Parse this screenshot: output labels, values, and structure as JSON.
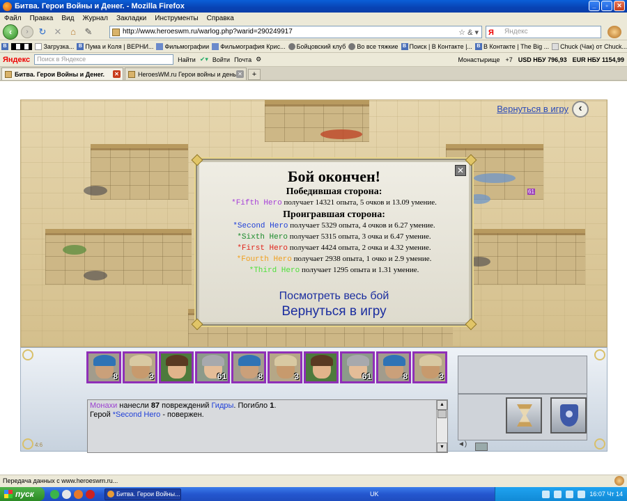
{
  "window": {
    "title": "Битва. Герои Войны и Денег. - Mozilla Firefox"
  },
  "menu": [
    "Файл",
    "Правка",
    "Вид",
    "Журнал",
    "Закладки",
    "Инструменты",
    "Справка"
  ],
  "nav": {
    "url": "http://www.heroeswm.ru/warlog.php?warid=290249917",
    "search_placeholder": "Яндекс",
    "search_logo": "Я"
  },
  "bookmarks": [
    "Загрузка...",
    "Пума и Коля | ВЕРНИ...",
    "Фильмографии",
    "Фильмография Крис...",
    "Бойцовский клуб",
    "Во все тяжкие",
    "Поиск | В Контакте |...",
    "В Контакте | The Big ...",
    "Chuck (Чак) от Chuck..."
  ],
  "yabar": {
    "logo": "Яндекс",
    "placeholder": "Поиск в Яндексе",
    "find": "Найти",
    "login": "Войти",
    "mail": "Почта",
    "city": "Монастырище",
    "temp": "+7",
    "usd": "USD НБУ 796,93",
    "eur": "EUR НБУ 1154,99"
  },
  "tabs": [
    {
      "label": "Битва. Герои Войны и Денег.",
      "active": true
    },
    {
      "label": "HeroesWM.ru Герои войны и деньг...",
      "active": false
    }
  ],
  "game": {
    "return_link": "Вернуться в игру",
    "modal": {
      "title": "Бой окончен!",
      "winners_heading": "Победившая сторона:",
      "losers_heading": "Проигравшая сторона:",
      "winners": [
        {
          "hero": "*Fifth Hero",
          "color": "#a640d8",
          "text": " получает 14321 опыта, 5 очков и 13.09 умение."
        }
      ],
      "losers": [
        {
          "hero": "*Second Hero",
          "color": "#1f3fd8",
          "text": " получает 5329 опыта, 4 очков и 6.27 умение."
        },
        {
          "hero": "*Sixth Hero",
          "color": "#1a8a2a",
          "text": " получает 5315 опыта, 3 очка и 6.47 умение."
        },
        {
          "hero": "*First Hero",
          "color": "#e0231a",
          "text": " получает 4424 опыта, 2 очка и 4.32 умение."
        },
        {
          "hero": "*Fourth Hero",
          "color": "#f0a020",
          "text": " получает 2938 опыта, 1 очко и 2.9 умение."
        },
        {
          "hero": "*Third Hero",
          "color": "#4ee03a",
          "text": " получает 1295 опыта и 1.31 умение."
        }
      ],
      "view_battle": "Посмотреть весь бой",
      "back_to_game": "Вернуться в игру"
    },
    "units": [
      {
        "type": "blue-helm",
        "count": "8"
      },
      {
        "type": "turban",
        "count": "3"
      },
      {
        "type": "bare",
        "count": ""
      },
      {
        "type": "steel-helm",
        "count": "61"
      },
      {
        "type": "blue-helm",
        "count": "8"
      },
      {
        "type": "turban",
        "count": "3"
      },
      {
        "type": "bare",
        "count": ""
      },
      {
        "type": "steel-helm",
        "count": "61"
      },
      {
        "type": "blue-helm",
        "count": "8"
      },
      {
        "type": "turban",
        "count": "3"
      }
    ],
    "log": {
      "line1": {
        "a": "Монахи",
        "b": " нанесли ",
        "c": "87",
        "d": " повреждений ",
        "e": "Гидры",
        "f": ". Погибло ",
        "g": "1",
        "h": "."
      },
      "line2": {
        "a": "Герой ",
        "b": "*Second Hero",
        "c": " - повержен."
      }
    },
    "counter": "4:6",
    "field_labels": [
      "61"
    ]
  },
  "status": "Передача данных с www.heroeswm.ru...",
  "taskbar": {
    "start": "пуск",
    "task": "Битва. Герои Войны...",
    "lang": "UK",
    "clock": "16:07 Чт 14"
  }
}
